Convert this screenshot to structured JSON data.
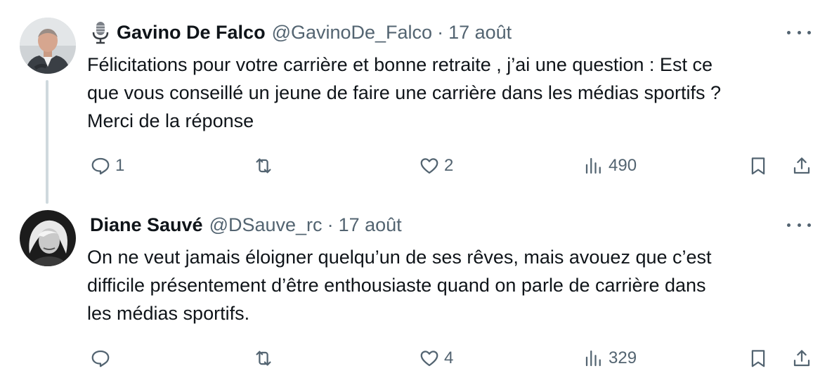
{
  "tweets": [
    {
      "author": {
        "name": "Gavino De Falco",
        "handle": "@GavinoDe_Falco",
        "badge_icon": "microphone-icon",
        "avatar_description": "man-in-suit-avatar"
      },
      "separator": "·",
      "date": "17 août",
      "text_lines": [
        "Félicitations pour votre carrière et bonne retraite , j’ai une question : Est ce",
        "que vous conseillé un jeune de faire une carrière dans les médias sportifs ?",
        "Merci de la réponse"
      ],
      "stats": {
        "replies": "1",
        "reposts": "",
        "likes": "2",
        "views": "490"
      }
    },
    {
      "author": {
        "name": "Diane Sauvé",
        "handle": "@DSauve_rc",
        "avatar_description": "blonde-woman-bw-avatar"
      },
      "separator": "·",
      "date": "17 août",
      "text_lines": [
        "On ne veut jamais éloigner quelqu’un de ses rêves, mais avouez que c’est",
        "difficile présentement d’être enthousiaste quand on parle de carrière dans",
        "les médias sportifs."
      ],
      "stats": {
        "replies": "",
        "reposts": "",
        "likes": "4",
        "views": "329"
      }
    }
  ],
  "colors": {
    "primary_text": "#0f1419",
    "secondary_text": "#536471",
    "thread_line": "#cfd9de",
    "background": "#ffffff"
  },
  "icons": [
    "reply-icon",
    "repost-icon",
    "like-icon",
    "views-icon",
    "bookmark-icon",
    "share-icon",
    "more-options-icon"
  ]
}
